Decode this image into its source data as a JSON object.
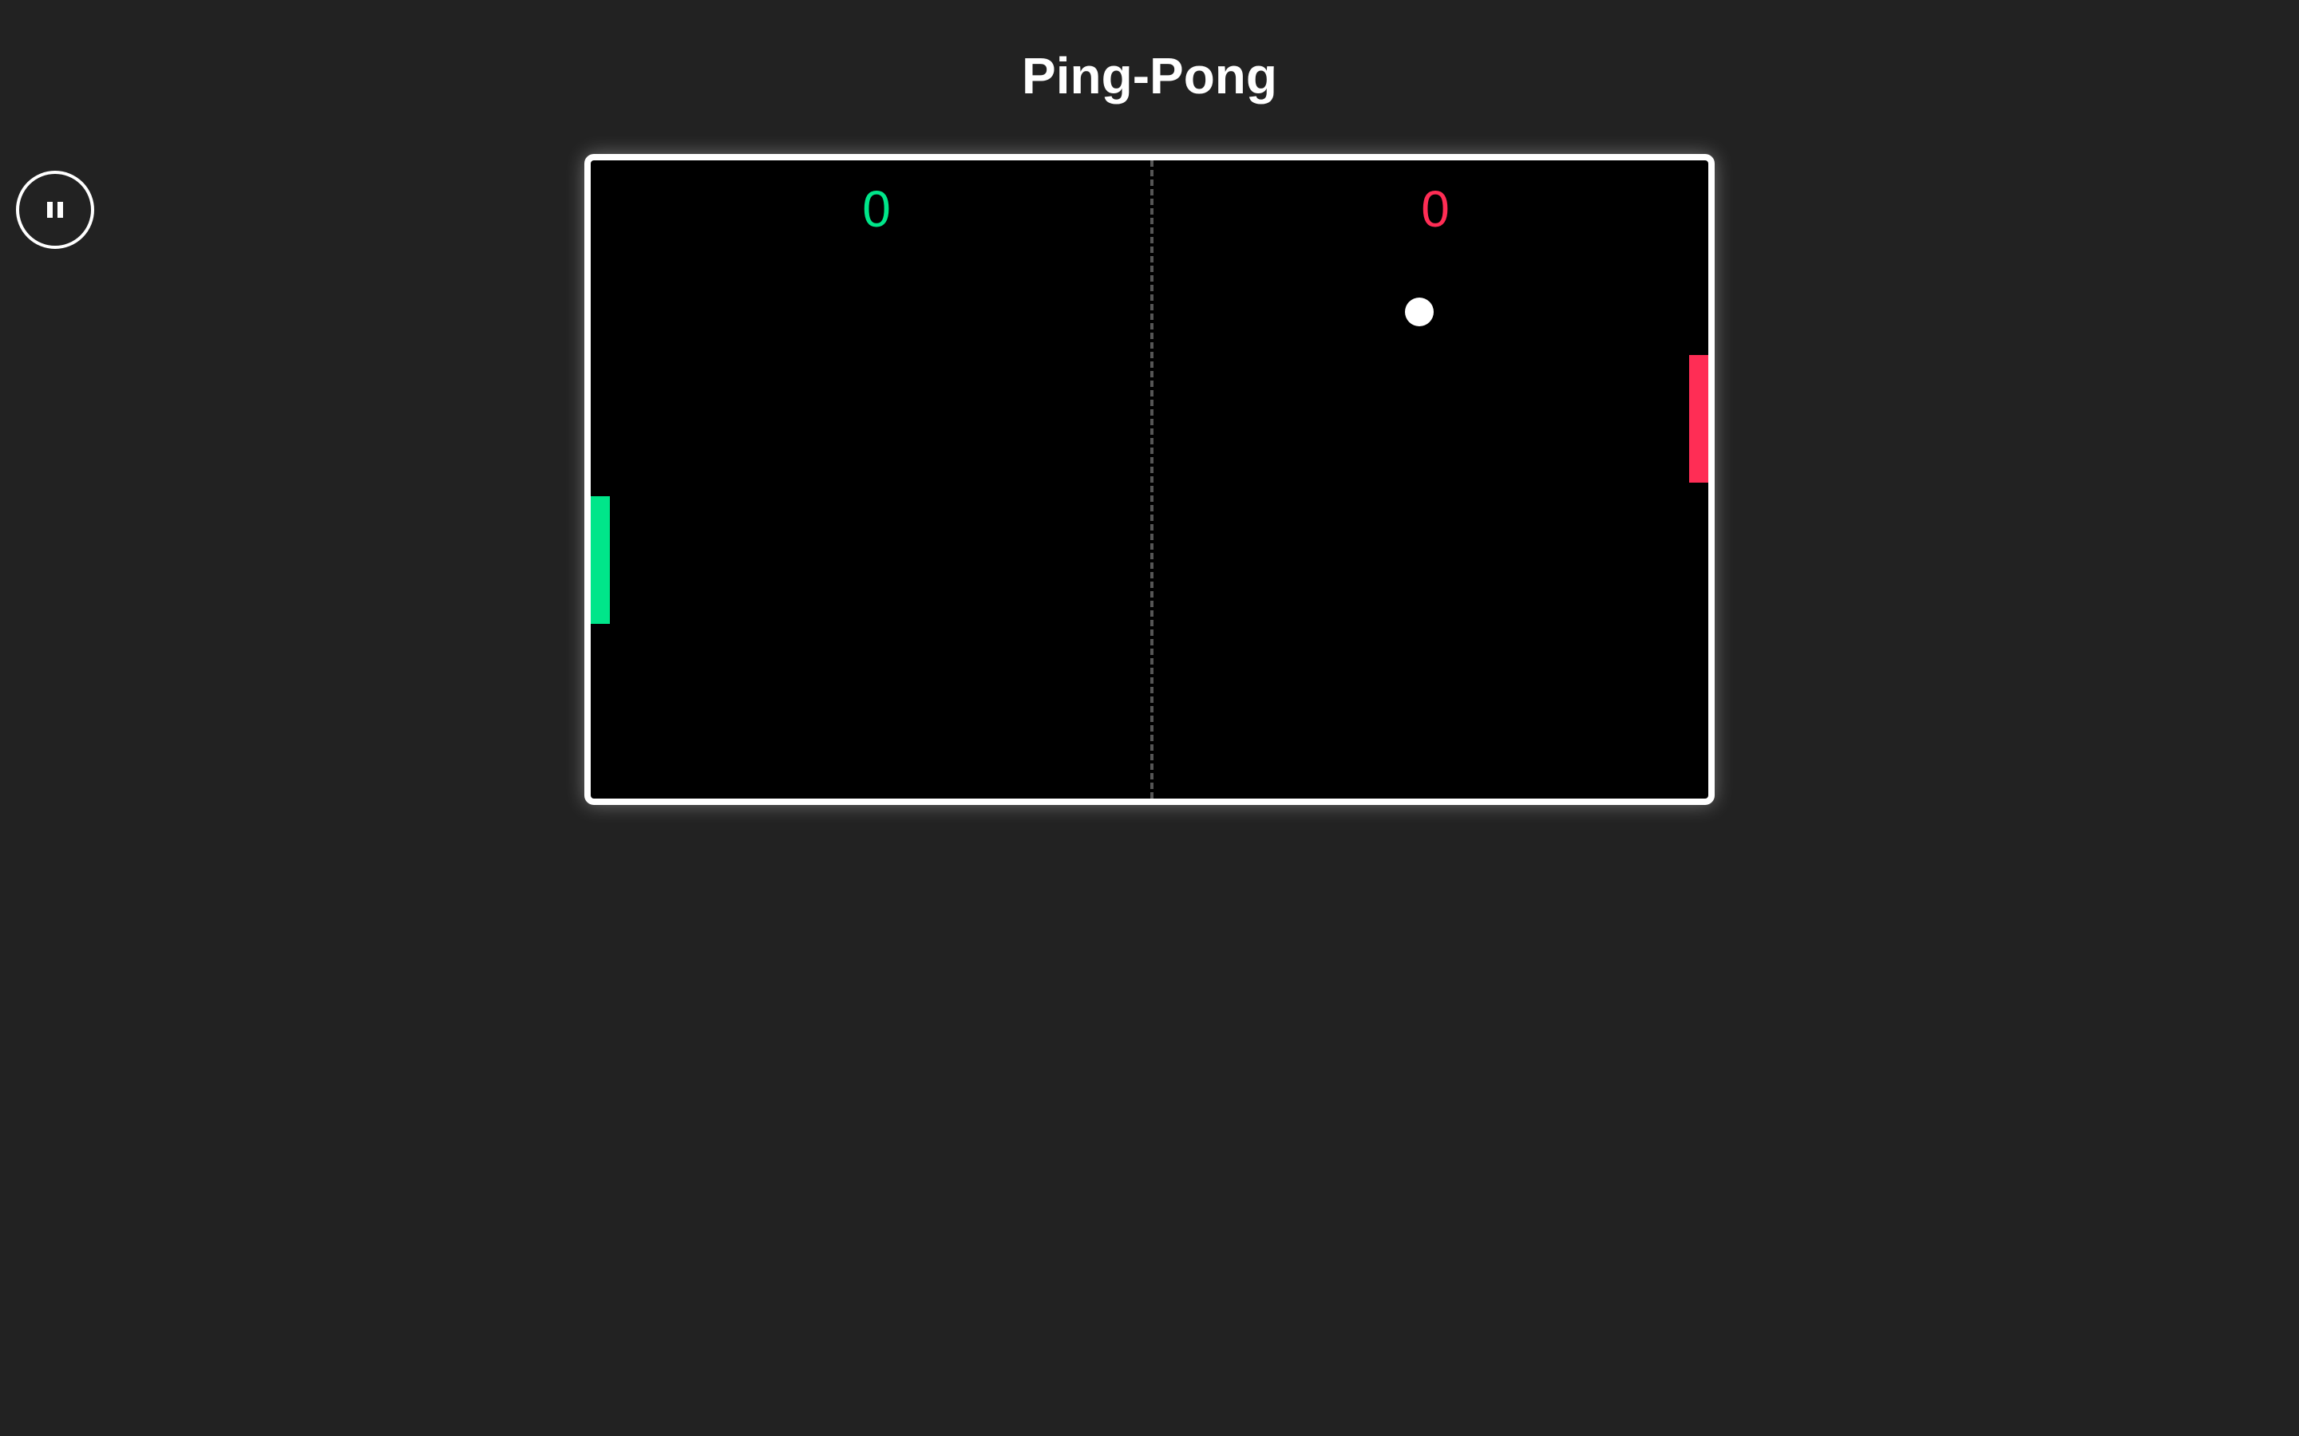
{
  "title": "Ping-Pong",
  "controls": {
    "pause_icon": "pause-icon"
  },
  "scoreboard": {
    "left_score": "0",
    "right_score": "0"
  },
  "colors": {
    "left_player": "#00e68a",
    "right_player": "#ff2d55",
    "ball": "#ffffff",
    "court_border": "#ffffff",
    "court_background": "#000000",
    "page_background": "#222222"
  }
}
